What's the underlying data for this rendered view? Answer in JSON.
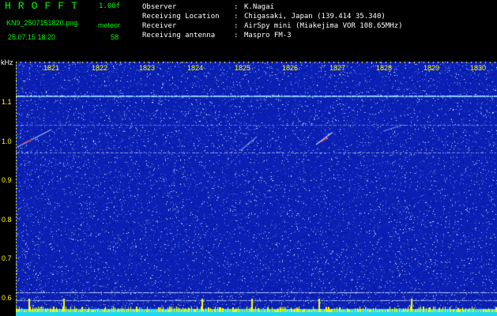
{
  "header": {
    "app_title": "HROFFT",
    "version": "1.00f",
    "filename": "KN9_2507151820.png",
    "meteor_label": "meteor",
    "datetime": "25.07.15 18:20",
    "meteor_count": "58"
  },
  "info": [
    {
      "key": "Observer",
      "value": "K.Nagai"
    },
    {
      "key": "Receiving Location",
      "value": "Chigasaki, Japan (139.414 35.340)"
    },
    {
      "key": "Receiver",
      "value": "AirSpy mini (Miakejima VOR 108.65MHz)"
    },
    {
      "key": "Receiving antenna",
      "value": "Maspro FM-3"
    }
  ],
  "colon": ":",
  "spectrogram": {
    "unit_label": "kHz",
    "freq_labels": [
      "1.1",
      "1.0",
      "0.9",
      "0.8",
      "0.7",
      "0.6"
    ],
    "time_labels": [
      "1821",
      "1822",
      "1823",
      "1824",
      "1825",
      "1826",
      "1827",
      "1828",
      "1829",
      "1830"
    ],
    "colors": {
      "background": "#0a1fb4",
      "noise_light": "#b9d8ff",
      "noise_white": "#ffffff",
      "trace": "#e8f2ff",
      "meteor_red": "#ff4040",
      "bottom_band": "#1fd8f5",
      "bottom_spikes": "#ffff00",
      "labels": "#ffff00"
    }
  }
}
